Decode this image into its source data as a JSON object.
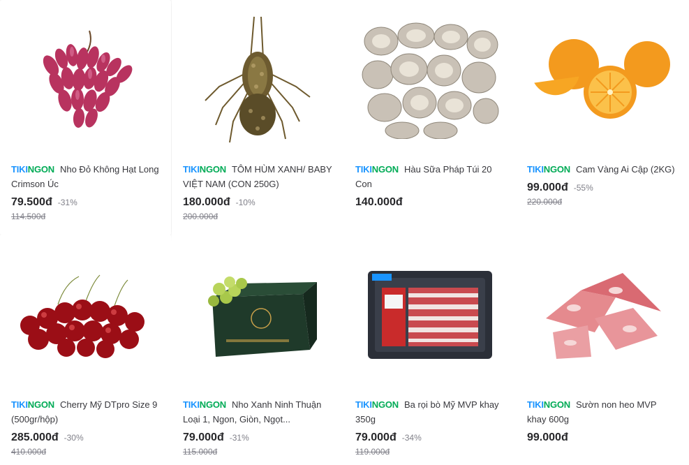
{
  "brand": {
    "part1": "TIKI",
    "part2": "NGON"
  },
  "products": [
    {
      "name": "Nho Đỏ Không Hạt Long Crimson Úc",
      "price": "79.500đ",
      "discount": "-31%",
      "original": "114.500đ",
      "image_icon": "red-grapes-image"
    },
    {
      "name": "TÔM HÙM XANH/ BABY VIỆT NAM (CON 250G)",
      "price": "180.000đ",
      "discount": "-10%",
      "original": "200.000đ",
      "image_icon": "lobster-image"
    },
    {
      "name": "Hàu Sữa Pháp Túi 20 Con",
      "price": "140.000đ",
      "discount": "",
      "original": "",
      "image_icon": "oysters-image"
    },
    {
      "name": "Cam Vàng Ai Cập (2KG)",
      "price": "99.000đ",
      "discount": "-55%",
      "original": "220.000đ",
      "image_icon": "oranges-image"
    },
    {
      "name": "Cherry Mỹ DTpro Size 9 (500gr/hộp)",
      "price": "285.000đ",
      "discount": "-30%",
      "original": "410.000đ",
      "image_icon": "cherries-image"
    },
    {
      "name": "Nho Xanh Ninh Thuận Loại 1, Ngon, Giòn, Ngọt...",
      "price": "79.000đ",
      "discount": "-31%",
      "original": "115.000đ",
      "image_icon": "green-grapes-box-image"
    },
    {
      "name": "Ba rọi bò Mỹ MVP khay 350g",
      "price": "79.000đ",
      "discount": "-34%",
      "original": "119.000đ",
      "image_icon": "beef-tray-image"
    },
    {
      "name": "Sườn non heo MVP khay 600g",
      "price": "99.000đ",
      "discount": "",
      "original": "",
      "image_icon": "pork-ribs-image"
    }
  ],
  "colors": {
    "brand_blue": "#1a94ff",
    "brand_green": "#00ab56",
    "price": "#27272a",
    "muted": "#808089"
  }
}
